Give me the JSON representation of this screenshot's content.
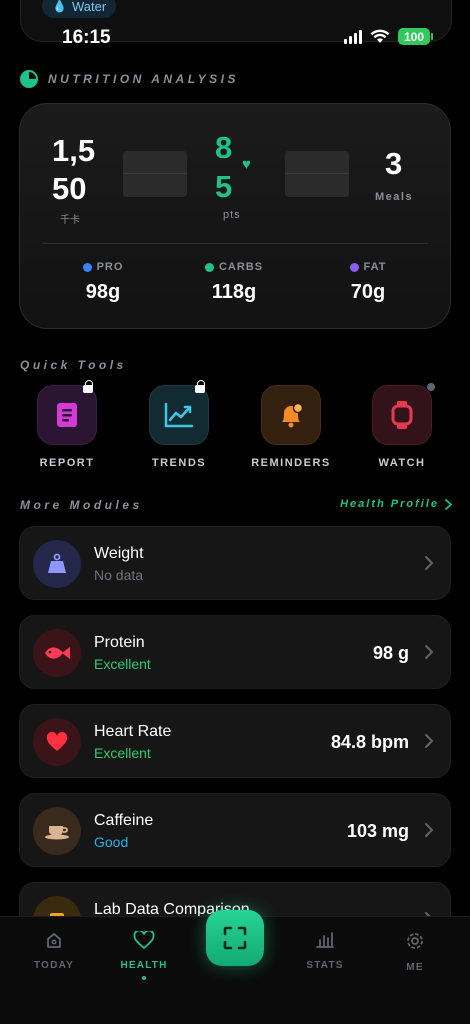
{
  "top_chip": {
    "label": "Water",
    "icon": "water-drop-icon"
  },
  "status_bar": {
    "time": "16:15",
    "battery": "100"
  },
  "nutrition": {
    "header": "NUTRITION ANALYSIS",
    "calories": {
      "value_line1": "1,5",
      "value_line2": "50",
      "unit": "千卡"
    },
    "score": {
      "value_line1": "8",
      "value_line2": "5",
      "unit": "pts"
    },
    "meals": {
      "value": "3",
      "unit": "Meals"
    },
    "macros": [
      {
        "label": "PRO",
        "value": "98g",
        "color": "#3b82f6"
      },
      {
        "label": "CARBS",
        "value": "118g",
        "color": "#1ec28b"
      },
      {
        "label": "FAT",
        "value": "70g",
        "color": "#8b5cf6"
      }
    ]
  },
  "quick_tools": {
    "header": "Quick Tools",
    "items": [
      {
        "label": "REPORT",
        "icon": "report-icon",
        "locked": true
      },
      {
        "label": "TRENDS",
        "icon": "trends-icon",
        "locked": true
      },
      {
        "label": "REMINDERS",
        "icon": "bell-icon",
        "locked": false
      },
      {
        "label": "WATCH",
        "icon": "watch-icon",
        "locked": false
      }
    ]
  },
  "modules": {
    "header": "More Modules",
    "link": "Health Profile",
    "items": [
      {
        "title": "Weight",
        "subtitle": "No data",
        "value": "",
        "icon": "scale-icon",
        "subtitle_color": "#6f7580"
      },
      {
        "title": "Protein",
        "subtitle": "Excellent",
        "value": "98 g",
        "icon": "fish-icon",
        "subtitle_color": "#2ecc71"
      },
      {
        "title": "Heart Rate",
        "subtitle": "Excellent",
        "value": "84.8 bpm",
        "icon": "heart-icon",
        "subtitle_color": "#2ecc71"
      },
      {
        "title": "Caffeine",
        "subtitle": "Good",
        "value": "103 mg",
        "icon": "coffee-cup-icon",
        "subtitle_color": "#2bb3e8"
      },
      {
        "title": "Lab Data Comparison",
        "subtitle": "",
        "value": "",
        "icon": "lab-icon",
        "subtitle_color": "#6f7580"
      }
    ]
  },
  "tab_bar": {
    "items": [
      {
        "label": "TODAY",
        "icon": "home-icon",
        "active": false
      },
      {
        "label": "HEALTH",
        "icon": "heart-icon",
        "active": true
      },
      {
        "label": "STATS",
        "icon": "bar-chart-icon",
        "active": false
      },
      {
        "label": "ME",
        "icon": "gear-icon",
        "active": false
      }
    ],
    "center_action_icon": "scan-icon"
  }
}
